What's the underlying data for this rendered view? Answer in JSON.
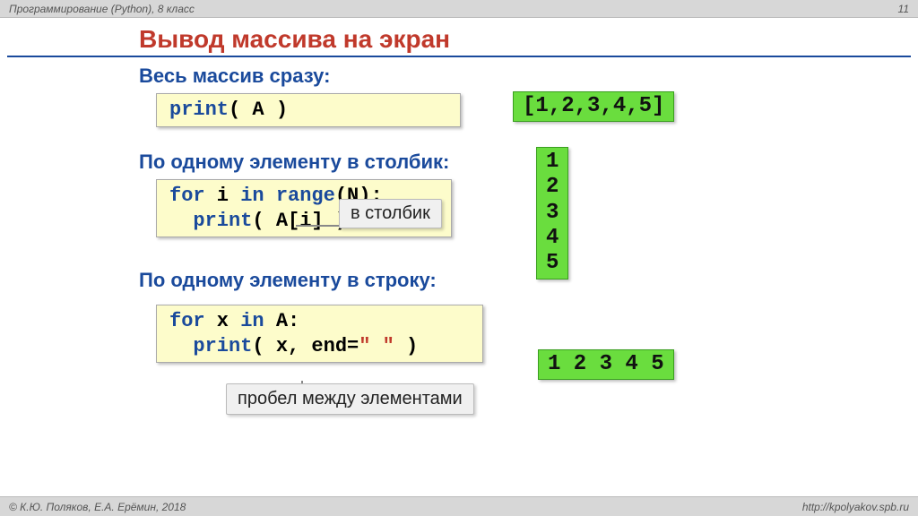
{
  "header": {
    "left": "Программирование (Python), 8 класс",
    "page_no": "11"
  },
  "title": "Вывод массива на экран",
  "sections": {
    "whole": {
      "heading": "Весь массив сразу:"
    },
    "column": {
      "heading": "По одному элементу в столбик:"
    },
    "row": {
      "heading": "По одному элементу в строку:"
    }
  },
  "code": {
    "cb1_print": "print",
    "cb1_rest": "( A )",
    "cb2_for": "for",
    "cb2_mid1": " i ",
    "cb2_in": "in",
    "cb2_mid2": " ",
    "cb2_range": "range",
    "cb2_rest1": "(N):",
    "cb2_indent": "  ",
    "cb2_print": "print",
    "cb2_rest2": "( A[i] )",
    "cb3_for": "for",
    "cb3_mid1": " x ",
    "cb3_in": "in",
    "cb3_rest1": " A:",
    "cb3_indent": "  ",
    "cb3_print": "print",
    "cb3_args": "( x, end=",
    "cb3_str": "\" \"",
    "cb3_close": " )"
  },
  "output": {
    "whole": "[1,2,3,4,5]",
    "column": "1\n2\n3\n4\n5",
    "row": "1 2 3 4 5"
  },
  "callouts": {
    "column_hint": "в столбик",
    "space_hint": "пробел между\nэлементами"
  },
  "footer": {
    "left": "© К.Ю. Поляков, Е.А. Ерёмин, 2018",
    "right": "http://kpolyakov.spb.ru"
  }
}
